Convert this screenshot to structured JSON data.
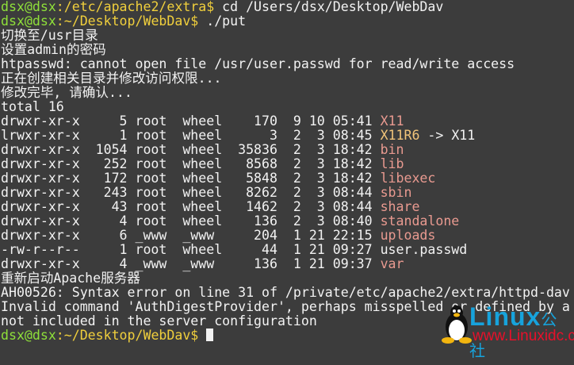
{
  "colors": {
    "background": "#3c3c3c",
    "prompt_user": "#8fe03a",
    "prompt_path": "#f0cf3c",
    "directory": "#e99a90",
    "symlink": "#f2c57a",
    "text": "#f2f2f2"
  },
  "lines": [
    [
      {
        "t": "dsx@dsx",
        "c": "g"
      },
      {
        "t": ":/etc/apache2/extra$",
        "c": "y"
      },
      {
        "t": " cd /Users/dsx/Desktop/WebDav",
        "c": "w"
      }
    ],
    [
      {
        "t": "dsx@dsx",
        "c": "g"
      },
      {
        "t": ":~/Desktop/WebDav$",
        "c": "y"
      },
      {
        "t": " ./put",
        "c": "w"
      }
    ],
    [
      {
        "t": "切换至/usr目录",
        "c": "w"
      }
    ],
    [
      {
        "t": "设置admin的密码",
        "c": "w"
      }
    ],
    [
      {
        "t": "htpasswd: cannot open file /usr/user.passwd for read/write access",
        "c": "w"
      }
    ],
    [
      {
        "t": "正在创建相关目录并修改访问权限...",
        "c": "w"
      }
    ],
    [
      {
        "t": "修改完毕, 请确认...",
        "c": "w"
      }
    ],
    [
      {
        "t": "total 16",
        "c": "w"
      }
    ],
    [
      {
        "t": "drwxr-xr-x     5 root  wheel    170  9 10 05:41 ",
        "c": "w"
      },
      {
        "t": "X11",
        "c": "d"
      }
    ],
    [
      {
        "t": "lrwxr-xr-x     1 root  wheel      3  2  3 08:45 ",
        "c": "w"
      },
      {
        "t": "X11R6",
        "c": "l"
      },
      {
        "t": " -> X11",
        "c": "w"
      }
    ],
    [
      {
        "t": "drwxr-xr-x  1054 root  wheel  35836  2  3 18:42 ",
        "c": "w"
      },
      {
        "t": "bin",
        "c": "d"
      }
    ],
    [
      {
        "t": "drwxr-xr-x   252 root  wheel   8568  2  3 18:42 ",
        "c": "w"
      },
      {
        "t": "lib",
        "c": "d"
      }
    ],
    [
      {
        "t": "drwxr-xr-x   172 root  wheel   5848  2  3 18:42 ",
        "c": "w"
      },
      {
        "t": "libexec",
        "c": "d"
      }
    ],
    [
      {
        "t": "drwxr-xr-x   243 root  wheel   8262  2  3 08:44 ",
        "c": "w"
      },
      {
        "t": "sbin",
        "c": "d"
      }
    ],
    [
      {
        "t": "drwxr-xr-x    43 root  wheel   1462  2  3 08:44 ",
        "c": "w"
      },
      {
        "t": "share",
        "c": "d"
      }
    ],
    [
      {
        "t": "drwxr-xr-x     4 root  wheel    136  2  3 08:40 ",
        "c": "w"
      },
      {
        "t": "standalone",
        "c": "d"
      }
    ],
    [
      {
        "t": "drwxr-xr-x     6 _www  _www     204  1 21 22:15 ",
        "c": "w"
      },
      {
        "t": "uploads",
        "c": "d"
      }
    ],
    [
      {
        "t": "-rw-r--r--     1 root  wheel     44  1 21 09:27 user.passwd",
        "c": "w"
      }
    ],
    [
      {
        "t": "drwxr-xr-x     4 _www  _www     136  1 21 09:37 ",
        "c": "w"
      },
      {
        "t": "var",
        "c": "d"
      }
    ],
    [
      {
        "t": "重新启动Apache服务器",
        "c": "w"
      }
    ],
    [
      {
        "t": "AH00526: Syntax error on line 31 of /private/etc/apache2/extra/httpd-dav",
        "c": "w"
      }
    ],
    [
      {
        "t": "Invalid command 'AuthDigestProvider', perhaps misspelled or defined by a",
        "c": "w"
      }
    ],
    [
      {
        "t": "not included in the server configuration",
        "c": "w"
      }
    ],
    [
      {
        "t": "dsx@dsx",
        "c": "g"
      },
      {
        "t": ":~/Desktop/WebDav$",
        "c": "y"
      },
      {
        "t": " ",
        "c": "w"
      }
    ]
  ],
  "watermark": {
    "brand": "Linux",
    "brand_cn": "公社",
    "url": "www.Linuxidc.com"
  }
}
